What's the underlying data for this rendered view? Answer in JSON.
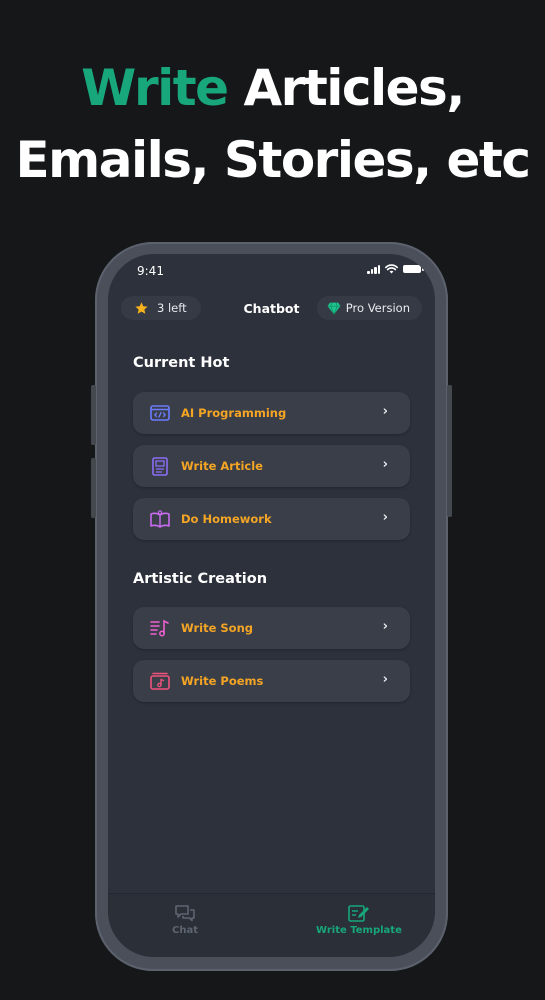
{
  "headline": {
    "accent_word": "Write",
    "line1_rest": " Articles,",
    "line2": "Emails, Stories, etc"
  },
  "status_bar": {
    "time": "9:41"
  },
  "top_bar": {
    "credits_label": "3 left",
    "title": "Chatbot",
    "pro_label": "Pro Version"
  },
  "sections": {
    "current_hot": {
      "title": "Current Hot",
      "items": [
        {
          "label": "AI Programming",
          "icon": "code-window-icon",
          "icon_color": "#6b7cff"
        },
        {
          "label": "Write Article",
          "icon": "document-icon",
          "icon_color": "#8b6ef5"
        },
        {
          "label": "Do Homework",
          "icon": "open-book-icon",
          "icon_color": "#c96cf0"
        }
      ]
    },
    "artistic_creation": {
      "title": "Artistic Creation",
      "items": [
        {
          "label": "Write Song",
          "icon": "music-list-icon",
          "icon_color": "#ee5fd0"
        },
        {
          "label": "Write Poems",
          "icon": "poem-book-icon",
          "icon_color": "#f0527c"
        }
      ]
    }
  },
  "tab_bar": {
    "tabs": [
      {
        "label": "Chat",
        "icon": "chat-bubbles-icon",
        "active": false
      },
      {
        "label": "Write Template",
        "icon": "edit-note-icon",
        "active": true
      }
    ]
  },
  "colors": {
    "accent_green": "#17a77a",
    "item_label_orange": "#f5a524",
    "background": "#151718",
    "screen_bg": "#2c313b"
  }
}
